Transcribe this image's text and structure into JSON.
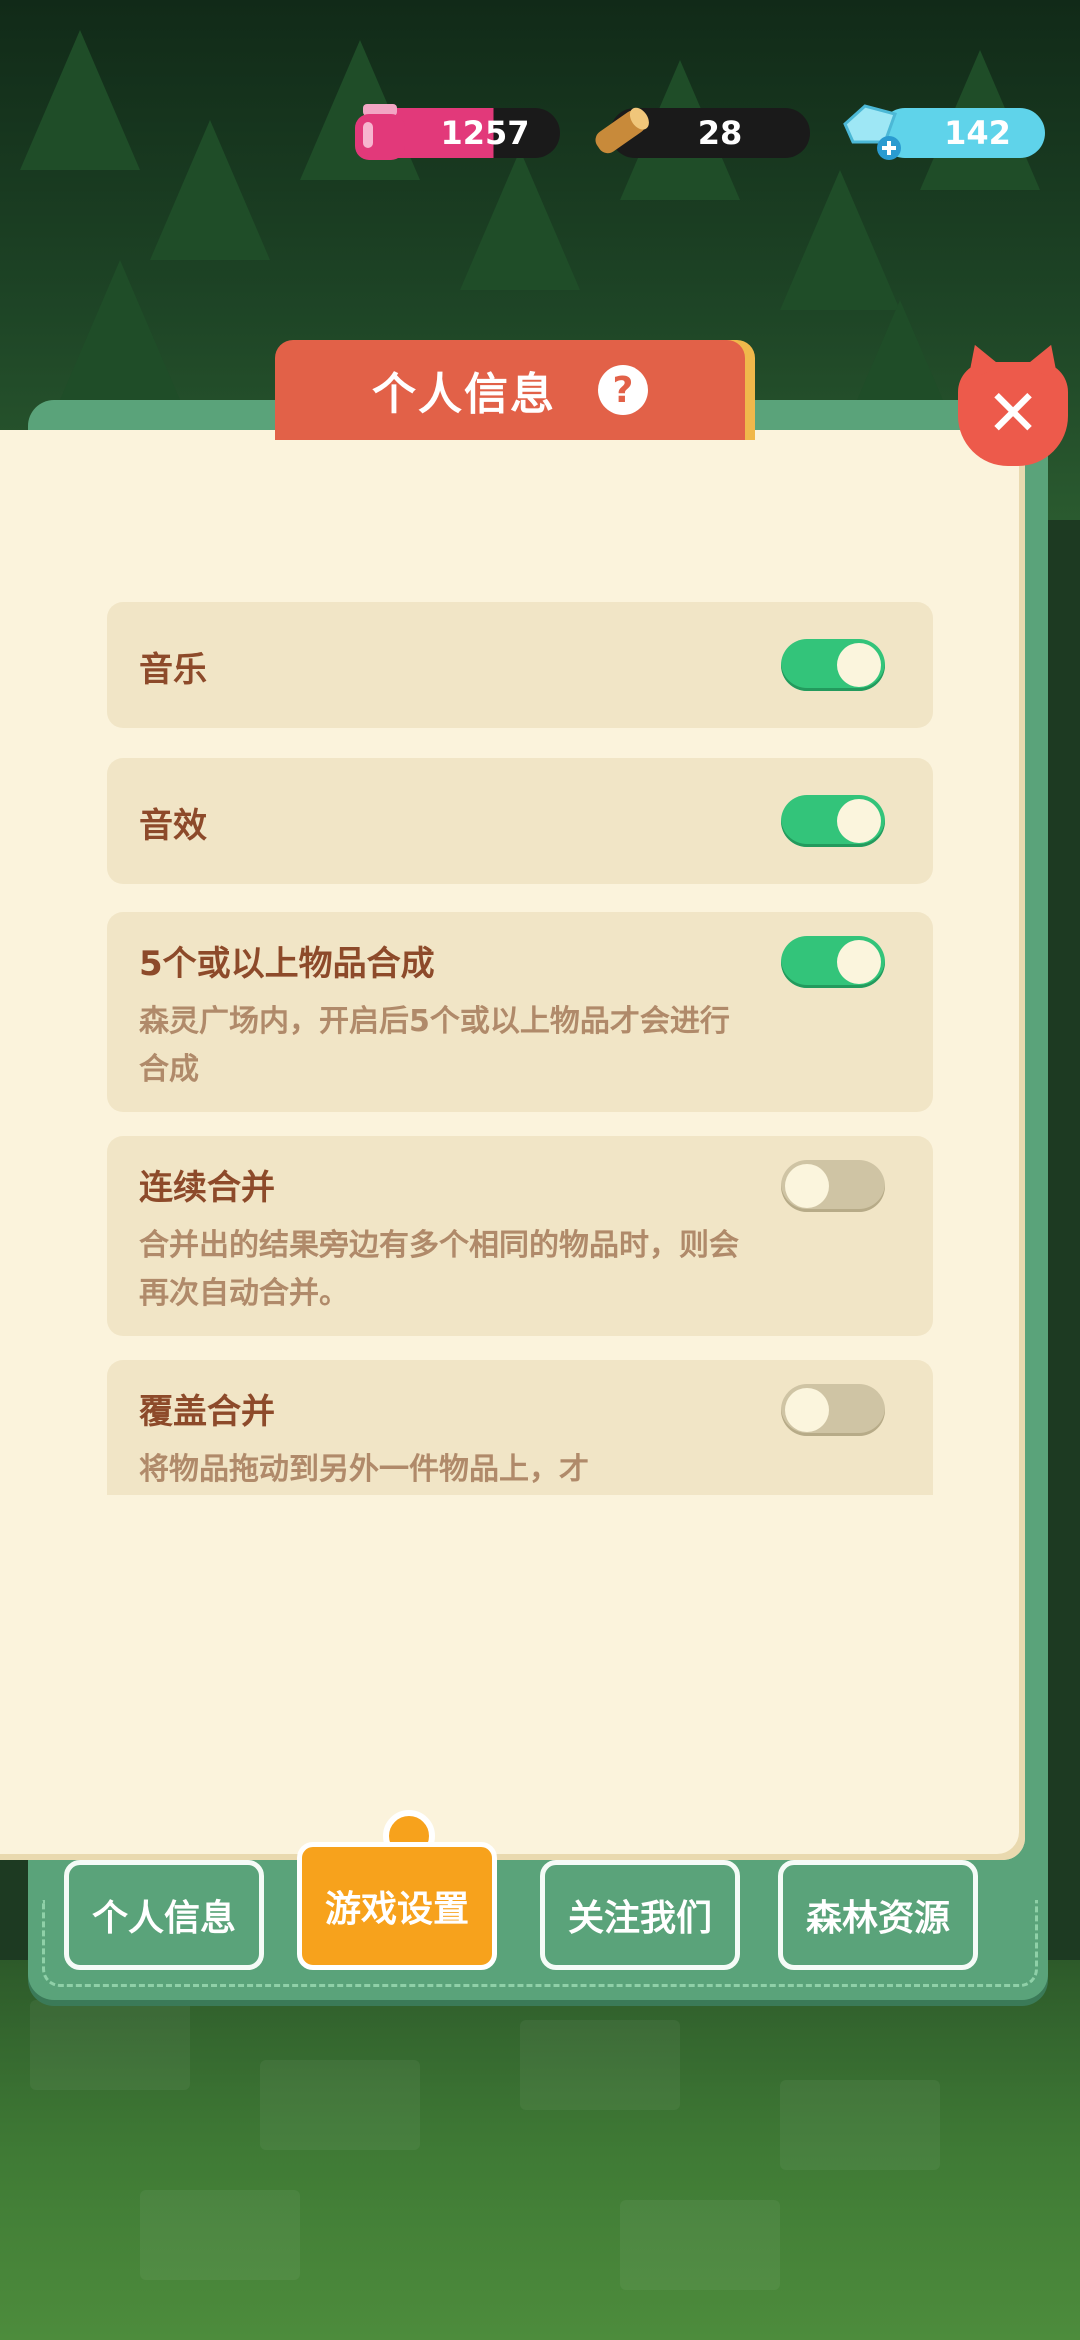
{
  "resources": {
    "ink": {
      "icon": "ink-jar-icon",
      "value": "1257"
    },
    "wood": {
      "icon": "wood-log-icon",
      "value": "28"
    },
    "gem": {
      "icon": "gem-plus-icon",
      "value": "142"
    }
  },
  "panel": {
    "title": "个人信息",
    "help_glyph": "?",
    "close_glyph": "✕"
  },
  "settings": [
    {
      "title": "音乐",
      "desc": "",
      "enabled": true
    },
    {
      "title": "音效",
      "desc": "",
      "enabled": true
    },
    {
      "title": "5个或以上物品合成",
      "desc": "森灵广场内，开启后5个或以上物品才会进行合成",
      "enabled": true
    },
    {
      "title": "连续合并",
      "desc": "合并出的结果旁边有多个相同的物品时，则会再次自动合并。",
      "enabled": false
    },
    {
      "title": "覆盖合并",
      "desc": "将物品拖动到另外一件物品上，才",
      "enabled": false
    }
  ],
  "tabs": [
    {
      "label": "个人信息",
      "active": false
    },
    {
      "label": "游戏设置",
      "active": true
    },
    {
      "label": "关注我们",
      "active": false
    },
    {
      "label": "森林资源",
      "active": false
    }
  ],
  "colors": {
    "toggle_on": "#33c47a",
    "toggle_off": "#cfc4a4",
    "title_tab": "#e26148",
    "active_tab": "#f7a21c",
    "panel_green": "#5aa37a"
  }
}
